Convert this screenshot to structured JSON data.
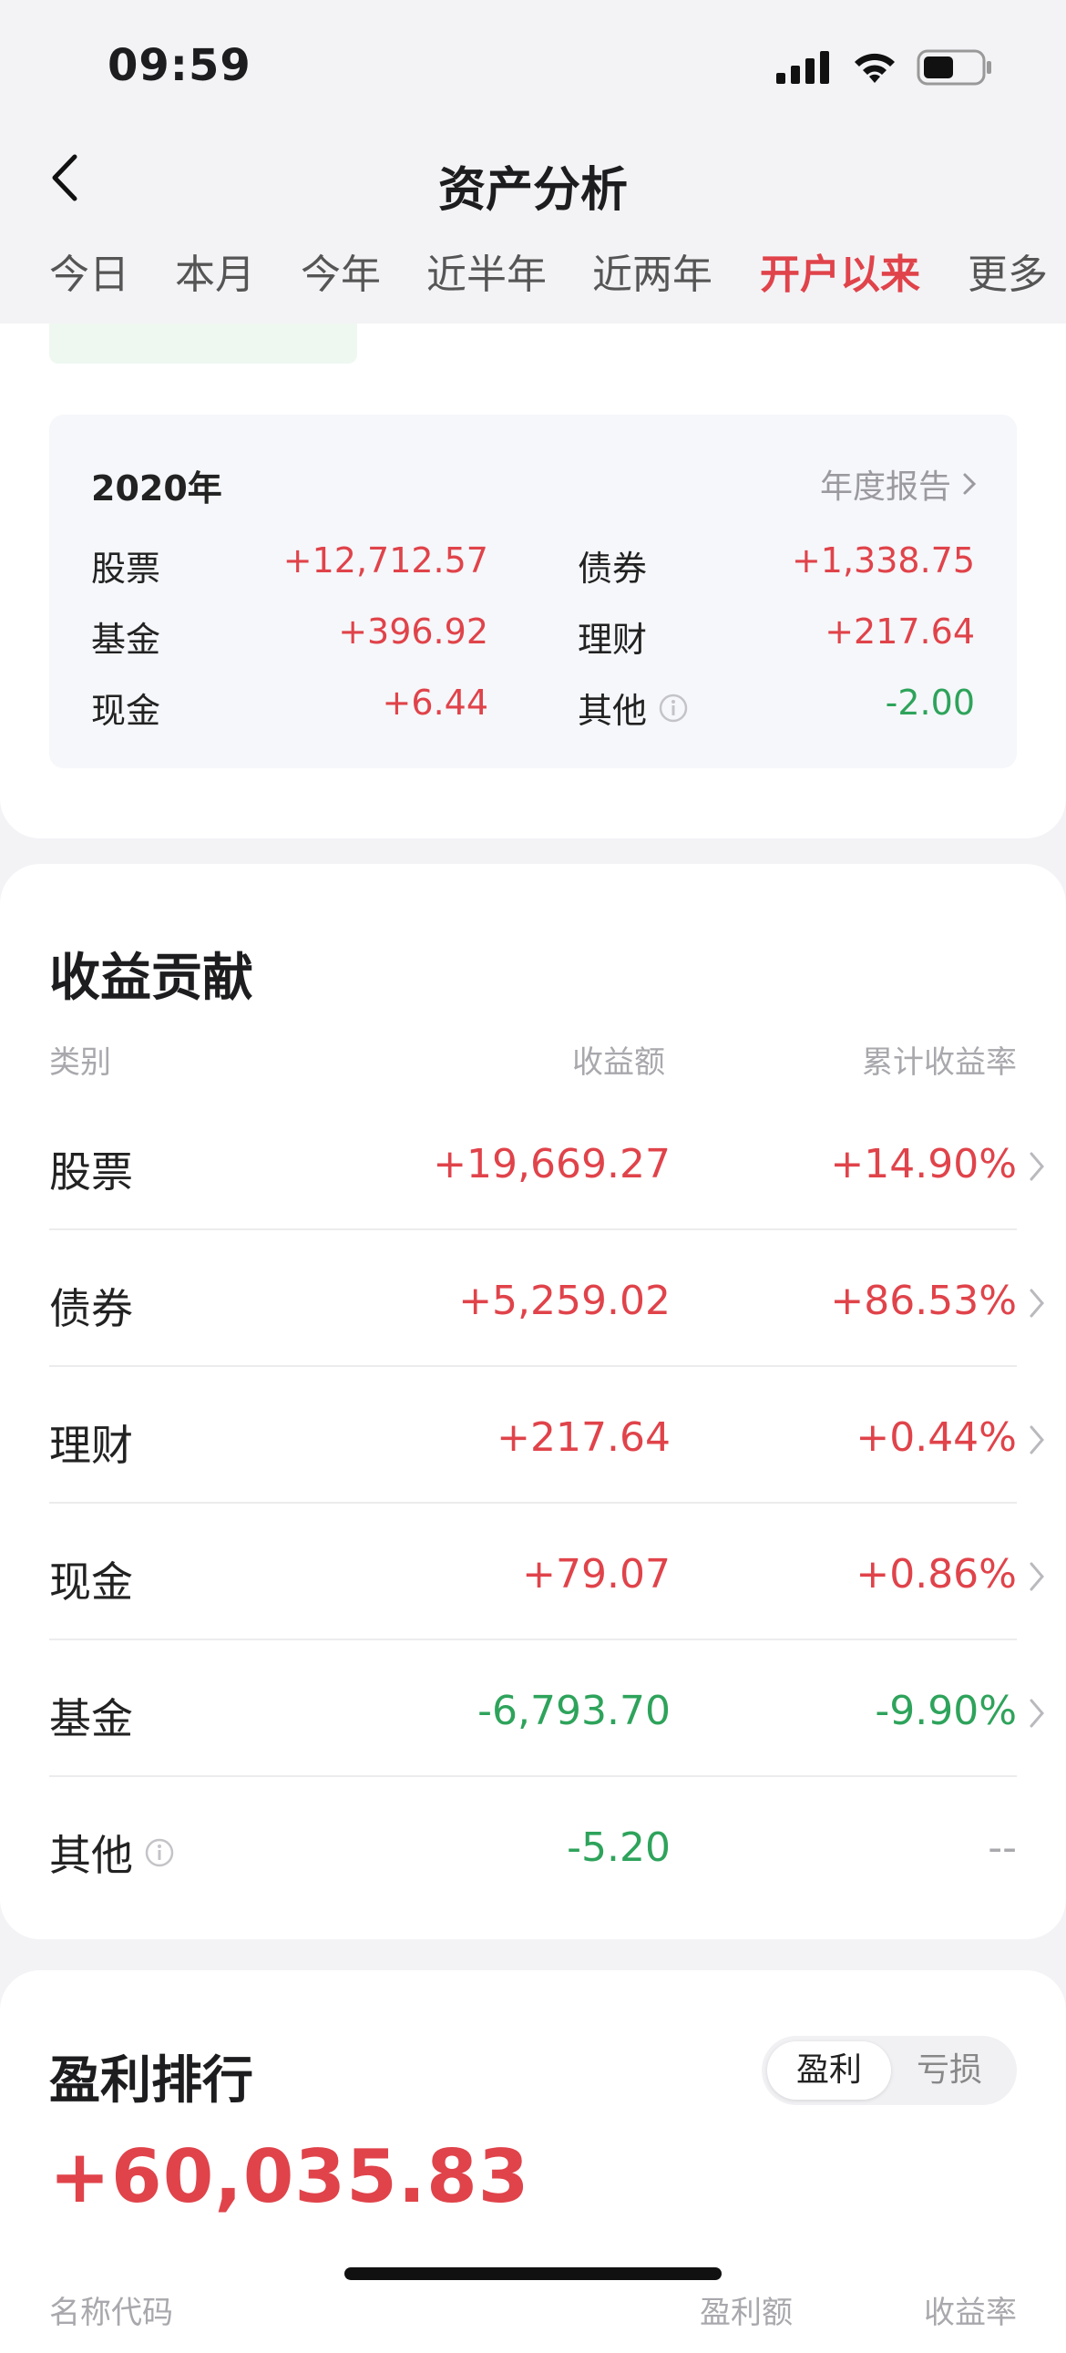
{
  "status": {
    "time": "09:59"
  },
  "header": {
    "title": "资产分析"
  },
  "tabs": [
    {
      "label": "今日",
      "active": false
    },
    {
      "label": "本月",
      "active": false
    },
    {
      "label": "今年",
      "active": false
    },
    {
      "label": "近半年",
      "active": false
    },
    {
      "label": "近两年",
      "active": false
    },
    {
      "label": "开户以来",
      "active": true
    },
    {
      "label": "更多",
      "active": false
    }
  ],
  "year_summary": {
    "title": "2020年",
    "report_link": "年度报告",
    "items": [
      {
        "label": "股票",
        "value": "+12,712.57"
      },
      {
        "label": "债券",
        "value": "+1,338.75"
      },
      {
        "label": "基金",
        "value": "+396.92"
      },
      {
        "label": "理财",
        "value": "+217.64"
      },
      {
        "label": "现金",
        "value": "+6.44"
      },
      {
        "label": "其他",
        "value": "-2.00"
      }
    ]
  },
  "contribution": {
    "title": "收益贡献",
    "headers": {
      "category": "类别",
      "amount": "收益额",
      "rate": "累计收益率"
    },
    "rows": [
      {
        "category": "股票",
        "amount": "+19,669.27",
        "rate": "+14.90%"
      },
      {
        "category": "债券",
        "amount": "+5,259.02",
        "rate": "+86.53%"
      },
      {
        "category": "理财",
        "amount": "+217.64",
        "rate": "+0.44%"
      },
      {
        "category": "现金",
        "amount": "+79.07",
        "rate": "+0.86%"
      },
      {
        "category": "基金",
        "amount": "-6,793.70",
        "rate": "-9.90%"
      },
      {
        "category": "其他",
        "amount": "-5.20",
        "rate": "--"
      }
    ]
  },
  "ranking": {
    "title": "盈利排行",
    "toggle": {
      "profit": "盈利",
      "loss": "亏损"
    },
    "total": "+60,035.83",
    "headers": {
      "name": "名称代码",
      "profit": "盈利额",
      "rate": "收益率"
    }
  },
  "colors": {
    "positive": "#e0434a",
    "negative": "#2ea35b",
    "muted": "#a8a8ad"
  }
}
